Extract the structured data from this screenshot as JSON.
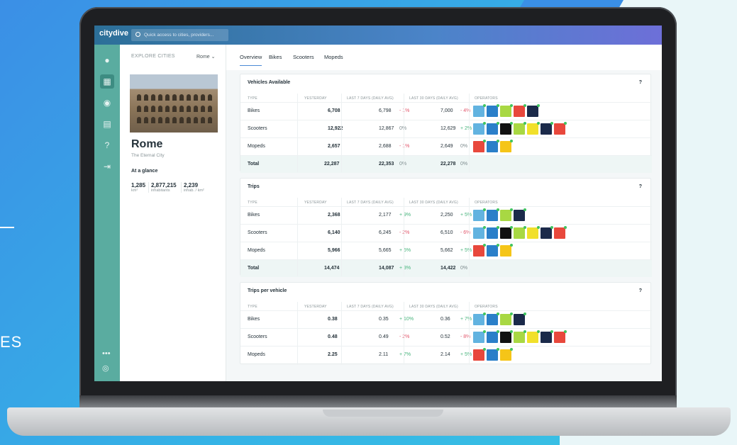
{
  "backdrop": {
    "side_text": "ES"
  },
  "app": {
    "logo": "citydive",
    "search_placeholder": "Quick access to cities, providers..."
  },
  "sidebar": {
    "items": [
      "pin-icon",
      "city-icon",
      "map-pin-icon",
      "report-icon",
      "help-icon",
      "export-icon"
    ],
    "more": "•••"
  },
  "city": {
    "explore_label": "EXPLORE CITIES",
    "selected": "Rome",
    "name": "Rome",
    "subtitle": "The Eternal City",
    "glance_label": "At a glance",
    "stats": [
      {
        "value": "1,285",
        "unit": "km²"
      },
      {
        "value": "2,877,215",
        "unit": "inhabitants"
      },
      {
        "value": "2,239",
        "unit": "inhab. / km²"
      }
    ]
  },
  "tabs": [
    "Overview",
    "Bikes",
    "Scooters",
    "Mopeds"
  ],
  "headers": {
    "type": "TYPE",
    "yesterday": "YESTERDAY",
    "last7": "LAST 7 DAYS (DAILY AVG)",
    "last30": "LAST 30 DAYS (DAILY AVG)",
    "operators": "OPERATORS"
  },
  "cards": [
    {
      "title": "Vehicles Available",
      "help": "?",
      "rows": [
        {
          "type": "Bikes",
          "y": "6,708",
          "l7": "6,798",
          "c7": "- 1%",
          "c7s": "neg",
          "l30": "7,000",
          "c30": "- 4%",
          "c30s": "neg",
          "ops": [
            "#62b3e0",
            "#2a7fc9",
            "#a8d843",
            "#e8483c",
            "#1b2a4a"
          ]
        },
        {
          "type": "Scooters",
          "y": "12,922",
          "l7": "12,867",
          "c7": "0%",
          "c7s": "zero",
          "l30": "12,629",
          "c30": "+ 2%",
          "c30s": "pos",
          "ops": [
            "#62b3e0",
            "#2a7fc9",
            "#111",
            "#a8d843",
            "#f1e02b",
            "#1b2a4a",
            "#e8483c"
          ]
        },
        {
          "type": "Mopeds",
          "y": "2,657",
          "l7": "2,688",
          "c7": "- 1%",
          "c7s": "neg",
          "l30": "2,649",
          "c30": "0%",
          "c30s": "zero",
          "ops": [
            "#e8483c",
            "#2a7fc9",
            "#f5c518"
          ]
        },
        {
          "type": "Total",
          "y": "22,287",
          "l7": "22,353",
          "c7": "0%",
          "c7s": "zero",
          "l30": "22,278",
          "c30": "0%",
          "c30s": "zero",
          "ops": [],
          "total": true
        }
      ]
    },
    {
      "title": "Trips",
      "help": "?",
      "rows": [
        {
          "type": "Bikes",
          "y": "2,368",
          "l7": "2,177",
          "c7": "+ 9%",
          "c7s": "pos",
          "l30": "2,250",
          "c30": "+ 5%",
          "c30s": "pos",
          "ops": [
            "#62b3e0",
            "#2a7fc9",
            "#a8d843",
            "#1b2a4a"
          ]
        },
        {
          "type": "Scooters",
          "y": "6,140",
          "l7": "6,245",
          "c7": "- 2%",
          "c7s": "neg",
          "l30": "6,510",
          "c30": "- 6%",
          "c30s": "neg",
          "ops": [
            "#62b3e0",
            "#2a7fc9",
            "#111",
            "#a8d843",
            "#f1e02b",
            "#1b2a4a",
            "#e8483c"
          ]
        },
        {
          "type": "Mopeds",
          "y": "5,966",
          "l7": "5,665",
          "c7": "+ 5%",
          "c7s": "pos",
          "l30": "5,662",
          "c30": "+ 5%",
          "c30s": "pos",
          "ops": [
            "#e8483c",
            "#2a7fc9",
            "#f5c518"
          ]
        },
        {
          "type": "Total",
          "y": "14,474",
          "l7": "14,087",
          "c7": "+ 3%",
          "c7s": "pos",
          "l30": "14,422",
          "c30": "0%",
          "c30s": "zero",
          "ops": [],
          "total": true
        }
      ]
    },
    {
      "title": "Trips per vehicle",
      "help": "?",
      "rows": [
        {
          "type": "Bikes",
          "y": "0.38",
          "l7": "0.35",
          "c7": "+ 10%",
          "c7s": "pos",
          "l30": "0.36",
          "c30": "+ 7%",
          "c30s": "pos",
          "ops": [
            "#62b3e0",
            "#2a7fc9",
            "#a8d843",
            "#1b2a4a"
          ]
        },
        {
          "type": "Scooters",
          "y": "0.48",
          "l7": "0.49",
          "c7": "- 2%",
          "c7s": "neg",
          "l30": "0.52",
          "c30": "- 8%",
          "c30s": "neg",
          "ops": [
            "#62b3e0",
            "#2a7fc9",
            "#111",
            "#a8d843",
            "#f1e02b",
            "#1b2a4a",
            "#e8483c"
          ]
        },
        {
          "type": "Mopeds",
          "y": "2.25",
          "l7": "2.11",
          "c7": "+ 7%",
          "c7s": "pos",
          "l30": "2.14",
          "c30": "+ 5%",
          "c30s": "pos",
          "ops": [
            "#e8483c",
            "#2a7fc9",
            "#f5c518"
          ]
        }
      ]
    }
  ]
}
